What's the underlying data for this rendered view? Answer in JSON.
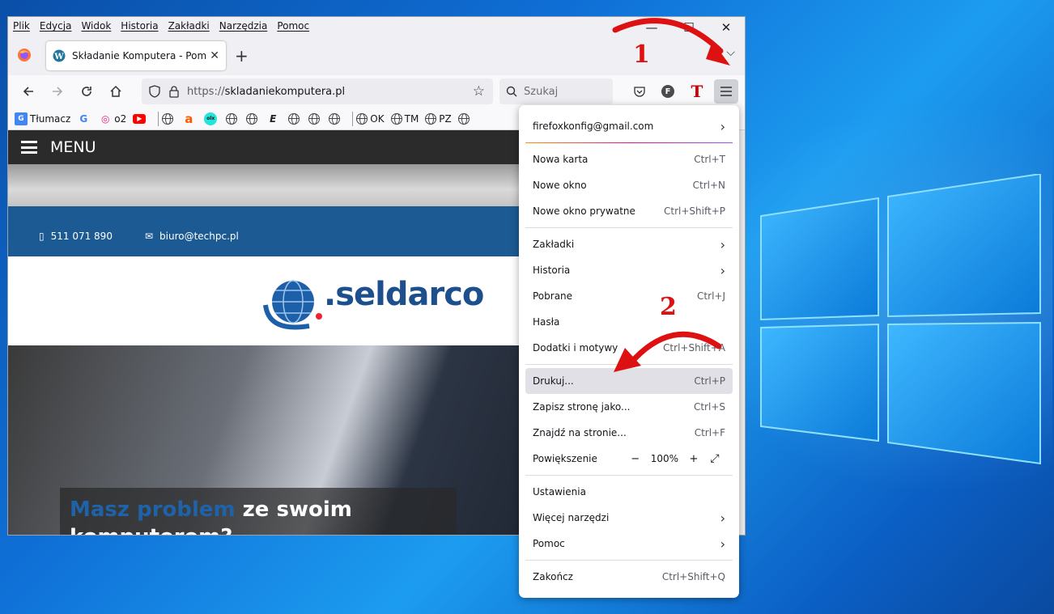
{
  "browser": {
    "menubar": [
      "Plik",
      "Edycja",
      "Widok",
      "Historia",
      "Zakładki",
      "Narzędzia",
      "Pomoc"
    ],
    "tab_title": "Składanie Komputera - Pomaga",
    "url_prefix": "https://",
    "url_host": "skladaniekomputera.pl",
    "search_placeholder": "Szukaj",
    "bookmarks": {
      "translate": "Tłumacz",
      "o2": "o2",
      "ok": "OK",
      "tm": "TM",
      "pz": "PZ"
    }
  },
  "website": {
    "menu_label": "MENU",
    "phone": "511 071 890",
    "email": "biuro@techpc.pl",
    "logo_text": ".seldarco",
    "hero_blue": "Masz problem",
    "hero_white": " ze swoim",
    "hero_line2": "komputerem?"
  },
  "app_menu": {
    "account": "firefoxkonfig@gmail.com",
    "items": [
      {
        "label": "Nowa karta",
        "shortcut": "Ctrl+T"
      },
      {
        "label": "Nowe okno",
        "shortcut": "Ctrl+N"
      },
      {
        "label": "Nowe okno prywatne",
        "shortcut": "Ctrl+Shift+P"
      },
      {
        "label": "Zakładki",
        "shortcut": ""
      },
      {
        "label": "Historia",
        "shortcut": ""
      },
      {
        "label": "Pobrane",
        "shortcut": "Ctrl+J"
      },
      {
        "label": "Hasła",
        "shortcut": ""
      },
      {
        "label": "Dodatki i motywy",
        "shortcut": "Ctrl+Shift+A"
      },
      {
        "label": "Drukuj...",
        "shortcut": "Ctrl+P"
      },
      {
        "label": "Zapisz stronę jako...",
        "shortcut": "Ctrl+S"
      },
      {
        "label": "Znajdź na stronie...",
        "shortcut": "Ctrl+F"
      },
      {
        "label": "Powiększenie",
        "shortcut": ""
      },
      {
        "label": "Ustawienia",
        "shortcut": ""
      },
      {
        "label": "Więcej narzędzi",
        "shortcut": ""
      },
      {
        "label": "Pomoc",
        "shortcut": ""
      },
      {
        "label": "Zakończ",
        "shortcut": "Ctrl+Shift+Q"
      }
    ],
    "zoom_value": "100%"
  },
  "annotations": {
    "step1": "1",
    "step2": "2"
  },
  "colors": {
    "annotation": "#dd1111",
    "site_blue": "#1c5a93",
    "menu_highlight": "#e0e0e6"
  }
}
